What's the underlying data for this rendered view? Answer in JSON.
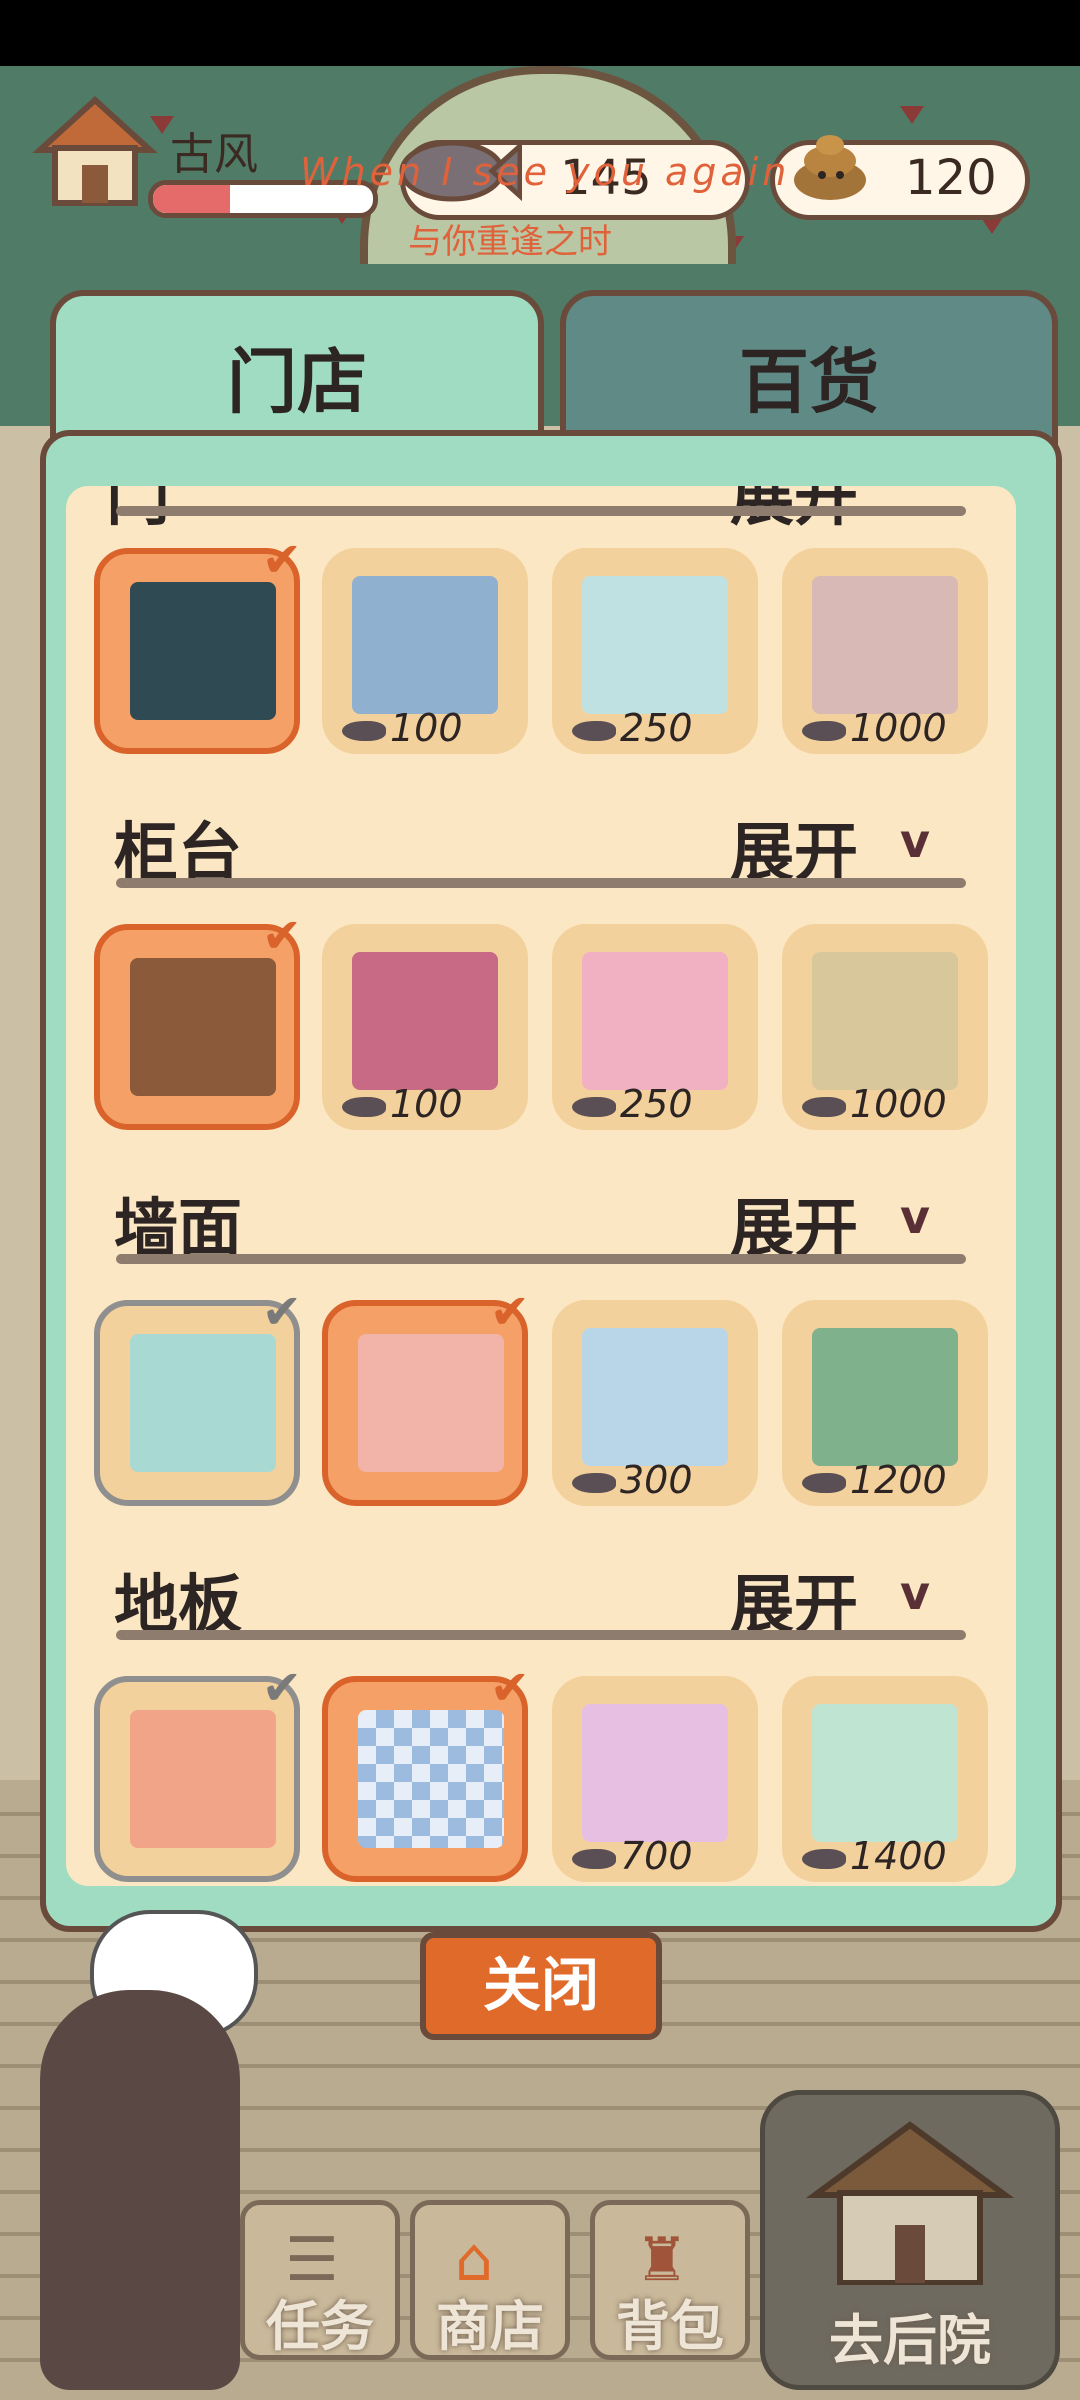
{
  "header": {
    "shop_name": "古风",
    "hp_fraction": 0.35,
    "fish_count": "145",
    "poop_count": "120",
    "watermark_line1": "When I see you again",
    "watermark_line2": "与你重逢之时"
  },
  "tabs": [
    {
      "label": "门店",
      "active": true
    },
    {
      "label": "百货",
      "active": false
    }
  ],
  "sections": [
    {
      "title": "门",
      "expand_label": "展开",
      "items": [
        {
          "state": "selected",
          "price": ""
        },
        {
          "state": "buy",
          "price": "100"
        },
        {
          "state": "buy",
          "price": "250"
        },
        {
          "state": "buy",
          "price": "1000"
        }
      ]
    },
    {
      "title": "柜台",
      "expand_label": "展开",
      "items": [
        {
          "state": "selected",
          "price": ""
        },
        {
          "state": "buy",
          "price": "100"
        },
        {
          "state": "buy",
          "price": "250"
        },
        {
          "state": "buy",
          "price": "1000"
        }
      ]
    },
    {
      "title": "墙面",
      "expand_label": "展开",
      "items": [
        {
          "state": "owned",
          "price": ""
        },
        {
          "state": "selected",
          "price": ""
        },
        {
          "state": "buy",
          "price": "300"
        },
        {
          "state": "buy",
          "price": "1200"
        }
      ]
    },
    {
      "title": "地板",
      "expand_label": "展开",
      "items": [
        {
          "state": "owned",
          "price": ""
        },
        {
          "state": "selected",
          "price": ""
        },
        {
          "state": "buy",
          "price": "700"
        },
        {
          "state": "buy",
          "price": "1400"
        }
      ]
    }
  ],
  "chevron": "v",
  "checkmark": "✔",
  "close_label": "关闭",
  "bottom_nav": [
    {
      "label": "任务",
      "icon": "task-icon"
    },
    {
      "label": "商店",
      "icon": "shop-icon"
    },
    {
      "label": "背包",
      "icon": "backpack-icon"
    },
    {
      "label": "去后院",
      "icon": "backyard-icon"
    }
  ],
  "colors": {
    "panel_green": "#9fdcc1",
    "panel_cream": "#fbe7c3",
    "selected_orange": "#f4a066",
    "accent_orange": "#e06a2a",
    "inactive_tab": "#5f8a86"
  }
}
